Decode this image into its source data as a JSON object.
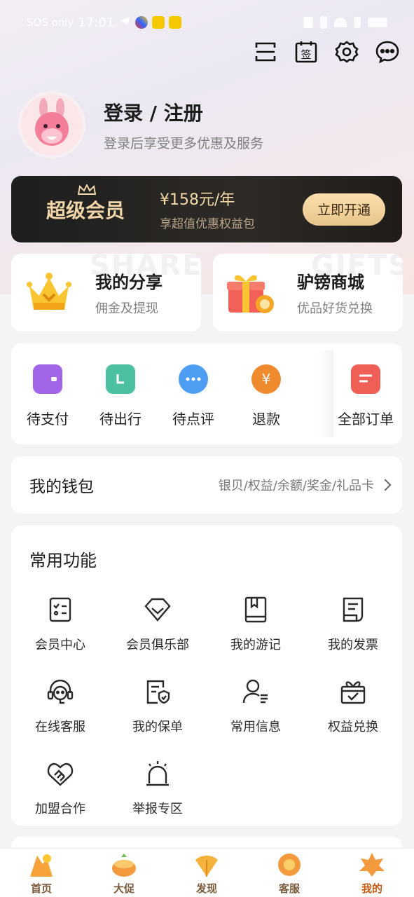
{
  "status_bar": {
    "carrier": "SOS only",
    "time": "17:01"
  },
  "profile": {
    "title": "登录 / 注册",
    "subtitle": "登录后享受更多优惠及服务"
  },
  "vip": {
    "logo": "超级会员",
    "price": "¥158元/年",
    "desc": "享超值优惠权益包",
    "button": "立即开通"
  },
  "promos": [
    {
      "title": "我的分享",
      "subtitle": "佣金及提现",
      "watermark": "SHARE",
      "icon": "crown-icon"
    },
    {
      "title": "驴镑商城",
      "subtitle": "优品好货兑换",
      "watermark": "GIFTS",
      "icon": "gift-icon"
    }
  ],
  "orders": [
    {
      "label": "待支付",
      "icon": "wallet-icon",
      "color": "#a264e8"
    },
    {
      "label": "待出行",
      "icon": "ticket-icon",
      "color": "#4cc1a2"
    },
    {
      "label": "待点评",
      "icon": "chat-bubble-icon",
      "color": "#4d9df3"
    },
    {
      "label": "退款",
      "icon": "yen-coin-icon",
      "color": "#f08a2e"
    },
    {
      "label": "全部订单",
      "icon": "order-list-icon",
      "color": "#f05f55"
    }
  ],
  "wallet": {
    "title": "我的钱包",
    "detail": "银贝/权益/余额/奖金/礼品卡"
  },
  "features": {
    "title": "常用功能",
    "items": [
      {
        "label": "会员中心",
        "icon": "checklist-icon"
      },
      {
        "label": "会员俱乐部",
        "icon": "diamond-icon"
      },
      {
        "label": "我的游记",
        "icon": "book-icon"
      },
      {
        "label": "我的发票",
        "icon": "invoice-icon"
      },
      {
        "label": "在线客服",
        "icon": "headset-icon"
      },
      {
        "label": "我的保单",
        "icon": "policy-shield-icon"
      },
      {
        "label": "常用信息",
        "icon": "user-info-icon"
      },
      {
        "label": "权益兑换",
        "icon": "exchange-gift-icon"
      },
      {
        "label": "加盟合作",
        "icon": "handshake-icon"
      },
      {
        "label": "举报专区",
        "icon": "alarm-icon"
      }
    ]
  },
  "tabbar": [
    {
      "label": "首页",
      "icon": "home-tab-icon"
    },
    {
      "label": "大促",
      "icon": "promo-tab-icon"
    },
    {
      "label": "发现",
      "icon": "discover-tab-icon"
    },
    {
      "label": "客服",
      "icon": "service-tab-icon"
    },
    {
      "label": "我的",
      "icon": "mine-tab-icon",
      "active": true
    }
  ]
}
